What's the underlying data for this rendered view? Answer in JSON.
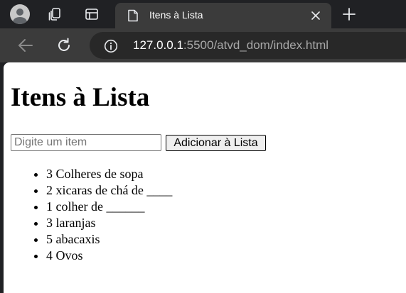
{
  "browser": {
    "tab": {
      "title": "Itens à Lista"
    },
    "address": {
      "host": "127.0.0.1",
      "rest": ":5500/atvd_dom/index.html"
    },
    "icons": {
      "profile": "profile-avatar-icon",
      "workspaces": "workspaces-icon",
      "tab_actions": "tab-actions-icon",
      "page": "page-icon",
      "close": "close-icon",
      "new_tab": "plus-icon",
      "back": "back-arrow-icon",
      "reload": "reload-icon",
      "site_info": "info-icon"
    },
    "colors": {
      "frame": "#202124",
      "toolbar": "#3b3b3b",
      "omnibox": "#282828"
    }
  },
  "page": {
    "heading": "Itens à Lista",
    "input": {
      "placeholder": "Digite um item",
      "value": ""
    },
    "add_button_label": "Adicionar à Lista",
    "items": [
      "3 Colheres de sopa",
      "2 xicaras de chá de ____",
      "1 colher de ______",
      "3 laranjas",
      "5 abacaxis",
      "4 Ovos"
    ]
  }
}
